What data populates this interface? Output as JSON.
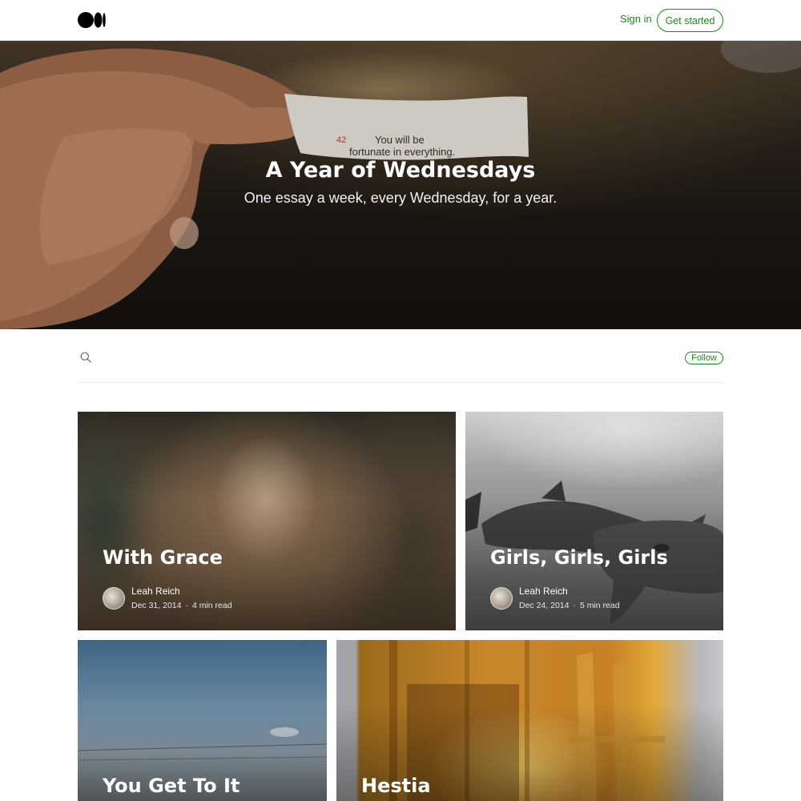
{
  "header": {
    "logo_icon": "medium-logo-icon",
    "sign_in_label": "Sign in",
    "get_started_label": "Get started"
  },
  "hero": {
    "title": "A Year of Wednesdays",
    "subtitle": "One essay a week, every Wednesday, for a year.",
    "fortune_text_line1": "You will be",
    "fortune_text_line2": "fortunate in everything."
  },
  "toolbar": {
    "search_icon": "search-icon",
    "follow_label": "Follow"
  },
  "posts": [
    {
      "title": "With Grace",
      "author": "Leah Reich",
      "date": "Dec 31, 2014",
      "read_time": "4 min read"
    },
    {
      "title": "Girls, Girls, Girls",
      "author": "Leah Reich",
      "date": "Dec 24, 2014",
      "read_time": "5 min read"
    },
    {
      "title": "You Get To It"
    },
    {
      "title": "Hestia"
    }
  ],
  "colors": {
    "accent_green": "#1a8917"
  }
}
